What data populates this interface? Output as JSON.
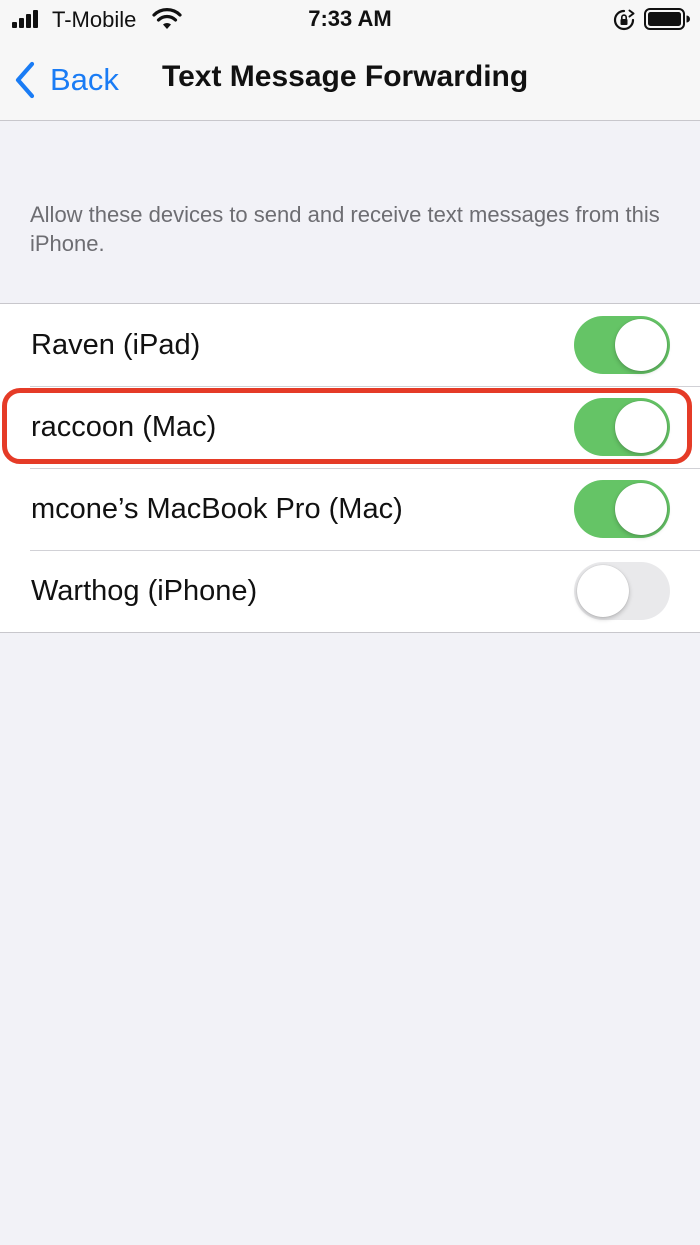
{
  "status_bar": {
    "carrier": "T-Mobile",
    "time": "7:33 AM",
    "icons": [
      "signal-icon",
      "wifi-icon",
      "rotation-lock-icon",
      "battery-icon"
    ]
  },
  "nav": {
    "back_label": "Back",
    "title": "Text Message Forwarding"
  },
  "section": {
    "footer": "Allow these devices to send and receive text messages from this iPhone."
  },
  "devices": [
    {
      "label": "Raven (iPad)",
      "enabled": true
    },
    {
      "label": "raccoon (Mac)",
      "enabled": true
    },
    {
      "label": "mcone’s MacBook Pro (Mac)",
      "enabled": true
    },
    {
      "label": "Warthog (iPhone)",
      "enabled": false
    }
  ],
  "colors": {
    "accent": "#1a7cf5",
    "toggle_on": "#65c466",
    "toggle_off": "#e9e9eb",
    "highlight": "#e53b27",
    "background": "#f2f2f7"
  }
}
